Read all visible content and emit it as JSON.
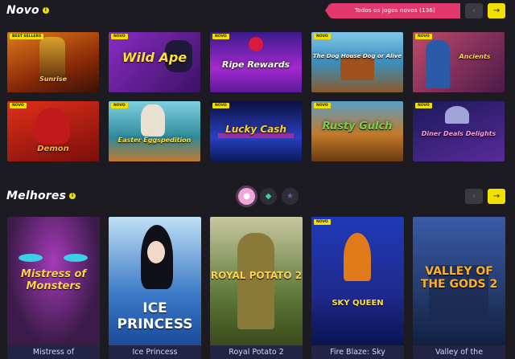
{
  "new_section": {
    "title": "Novo",
    "view_all_label": "Todos os jogos novos (136)",
    "tiles": [
      {
        "badge": "Best sellers",
        "name": "Sunrise",
        "bg": "#c35a16"
      },
      {
        "badge": "Novo",
        "name": "Wild Ape",
        "bg": "#5b1f8c"
      },
      {
        "badge": "Novo",
        "name": "Ripe Rewards",
        "bg": "#7a1ea8"
      },
      {
        "badge": "Novo",
        "name": "The Dog House Dog or Alive",
        "bg": "#3a8fbf"
      },
      {
        "badge": "Novo",
        "name": "Ancients",
        "bg": "#7a2a5c"
      },
      {
        "badge": "Novo",
        "name": "Demon",
        "bg": "#b5241c"
      },
      {
        "badge": "Novo",
        "name": "Easter Eggspedition",
        "bg": "#2f8a9a"
      },
      {
        "badge": "Novo",
        "name": "Lucky Cash",
        "bg": "#1b2a86"
      },
      {
        "badge": "Novo",
        "name": "Rusty Gulch",
        "bg": "#c27a2a"
      },
      {
        "badge": "Novo",
        "name": "Diner Deals Delights",
        "bg": "#2a2a78"
      }
    ]
  },
  "best_section": {
    "title": "Melhores",
    "cards": [
      {
        "badge": "",
        "art_title": "Mistress of Monsters",
        "caption": "Mistress of",
        "bg": "#3c1b4a"
      },
      {
        "badge": "",
        "art_title": "ICE PRINCESS",
        "caption": "Ice Princess",
        "bg": "#3c7ac8"
      },
      {
        "badge": "",
        "art_title": "ROYAL POTATO 2",
        "caption": "Royal Potato 2",
        "bg": "#5f7a3a"
      },
      {
        "badge": "Novo",
        "art_title": "SKY QUEEN",
        "caption": "Fire Blaze: Sky",
        "bg": "#1f2a8c"
      },
      {
        "badge": "",
        "art_title": "VALLEY OF THE GODS 2",
        "caption": "Valley of the",
        "bg": "#243a6a"
      }
    ]
  },
  "icons": {
    "info": "info-icon",
    "prev": "chevron-left-icon",
    "next": "arrow-right-icon",
    "tab1": "coin-icon",
    "tab2": "diamond-icon",
    "tab3": "star-icon"
  },
  "colors": {
    "accent": "#f2e000",
    "pink": "#e2386e",
    "bg": "#1c1b22"
  }
}
